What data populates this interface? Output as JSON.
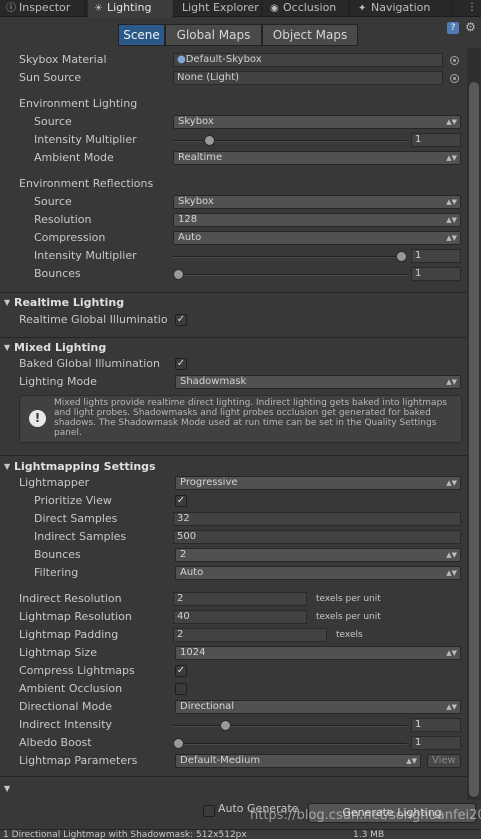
{
  "tabs": [
    {
      "label": "Inspector",
      "icon": "info-icon"
    },
    {
      "label": "Lighting",
      "icon": "sun-icon"
    },
    {
      "label": "Light Explorer",
      "icon": ""
    },
    {
      "label": "Occlusion",
      "icon": "eye-icon"
    },
    {
      "label": "Navigation",
      "icon": "compass-icon"
    }
  ],
  "toolbar": {
    "segments": [
      "Scene",
      "Global Maps",
      "Object Maps"
    ],
    "help_glyph": "?",
    "gear_glyph": "⚙"
  },
  "scene": {
    "skybox_material_label": "Skybox Material",
    "skybox_material_value": "Default-Skybox",
    "sun_source_label": "Sun Source",
    "sun_source_value": "None (Light)",
    "env_lighting_label": "Environment Lighting",
    "env_source_label": "Source",
    "env_source_value": "Skybox",
    "intensity_multiplier_label": "Intensity Multiplier",
    "intensity_multiplier_value": "1",
    "ambient_mode_label": "Ambient Mode",
    "ambient_mode_value": "Realtime",
    "env_reflections_label": "Environment Reflections",
    "refl_source_label": "Source",
    "refl_source_value": "Skybox",
    "resolution_label": "Resolution",
    "resolution_value": "128",
    "compression_label": "Compression",
    "compression_value": "Auto",
    "refl_intensity_label": "Intensity Multiplier",
    "refl_intensity_value": "1",
    "bounces_label": "Bounces",
    "bounces_value": "1"
  },
  "realtime": {
    "title": "Realtime Lighting",
    "gi_label": "Realtime Global Illuminatio"
  },
  "mixed": {
    "title": "Mixed Lighting",
    "baked_gi_label": "Baked Global Illumination",
    "lighting_mode_label": "Lighting Mode",
    "lighting_mode_value": "Shadowmask",
    "info_icon": "!",
    "info_text": "Mixed lights provide realtime direct lighting. Indirect lighting gets baked into lightmaps and light probes. Shadowmasks and light probes occlusion get generated for baked shadows. The Shadowmask Mode used at run time can be set in the Quality Settings panel."
  },
  "lightmapping": {
    "title": "Lightmapping Settings",
    "lightmapper_label": "Lightmapper",
    "lightmapper_value": "Progressive",
    "prioritize_view_label": "Prioritize View",
    "direct_samples_label": "Direct Samples",
    "direct_samples_value": "32",
    "indirect_samples_label": "Indirect Samples",
    "indirect_samples_value": "500",
    "bounces_label": "Bounces",
    "bounces_value": "2",
    "filtering_label": "Filtering",
    "filtering_value": "Auto",
    "indirect_resolution_label": "Indirect Resolution",
    "indirect_resolution_value": "2",
    "lightmap_resolution_label": "Lightmap Resolution",
    "lightmap_resolution_value": "40",
    "texels_per_unit": "texels per unit",
    "lightmap_padding_label": "Lightmap Padding",
    "lightmap_padding_value": "2",
    "texels": "texels",
    "lightmap_size_label": "Lightmap Size",
    "lightmap_size_value": "1024",
    "compress_label": "Compress Lightmaps",
    "ambient_occlusion_label": "Ambient Occlusion",
    "directional_mode_label": "Directional Mode",
    "directional_mode_value": "Directional",
    "indirect_intensity_label": "Indirect Intensity",
    "indirect_intensity_value": "1",
    "albedo_boost_label": "Albedo Boost",
    "albedo_boost_value": "1",
    "params_label": "Lightmap Parameters",
    "params_value": "Default-Medium",
    "view_label": "View"
  },
  "sliders": {
    "intensity_multiplier": 0.14,
    "refl_intensity": 1.0,
    "bounces": 0.0,
    "indirect_intensity": 0.21,
    "albedo_boost": 0.0
  },
  "bottom": {
    "auto_generate_label": "Auto Generate",
    "generate_label": "Generate Lighting",
    "status_text": "1 Directional Lightmap with Shadowmask: 512x512px",
    "status_size": "1.3 MB",
    "watermark": "https://blog.csdn.net/songhuanfei2017"
  },
  "colors": {
    "active_segment": "#2b5a8a",
    "panel_bg": "#383838"
  }
}
